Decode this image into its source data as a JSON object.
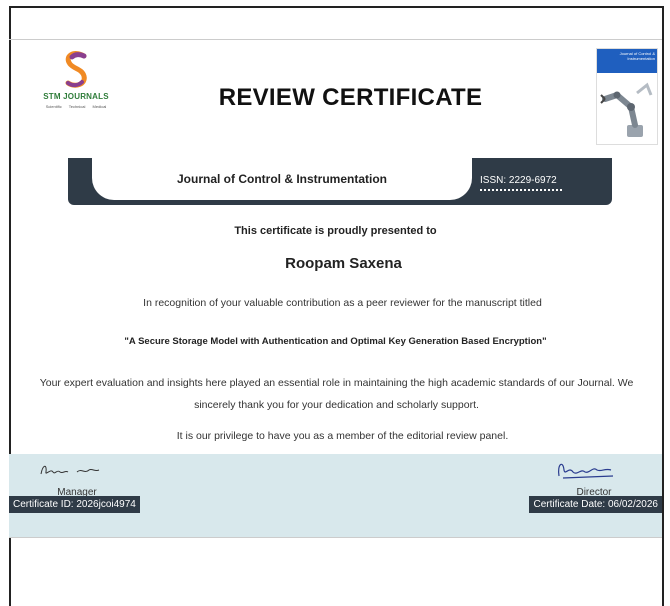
{
  "header": {
    "logo_name": "STM JOURNALS",
    "logo_tagline": "Scientific   Technical   Medical",
    "title": "REVIEW CERTIFICATE",
    "journal_cover_title": "Journal of Control & Instrumentation"
  },
  "journal": {
    "name": "Journal of Control & Instrumentation",
    "issn": "ISSN: 2229-6972"
  },
  "body": {
    "presented_to": "This certificate is proudly presented to",
    "recipient": "Roopam Saxena",
    "recognition": "In recognition of your valuable contribution as a peer reviewer for the manuscript titled",
    "manuscript_title": "\"A Secure Storage Model with Authentication and Optimal Key Generation Based Encryption\"",
    "evaluation": "Your expert evaluation and insights here played an essential role in maintaining the high academic standards of our Journal. We sincerely thank you for your dedication and scholarly support.",
    "privilege": "It is our privilege to have you as a member of the editorial review panel."
  },
  "signatures": {
    "manager_label": "Manager",
    "director_label": "Director"
  },
  "footer": {
    "certificate_id": "Certificate ID: 2026jcoi4974",
    "certificate_date": "Certificate Date: 06/02/2026"
  },
  "colors": {
    "dark_bar": "#2f3b47",
    "signature_band": "#d8e8ec",
    "logo_green": "#2f7d3a",
    "logo_orange": "#f08a24",
    "logo_purple": "#8a3f8f"
  }
}
